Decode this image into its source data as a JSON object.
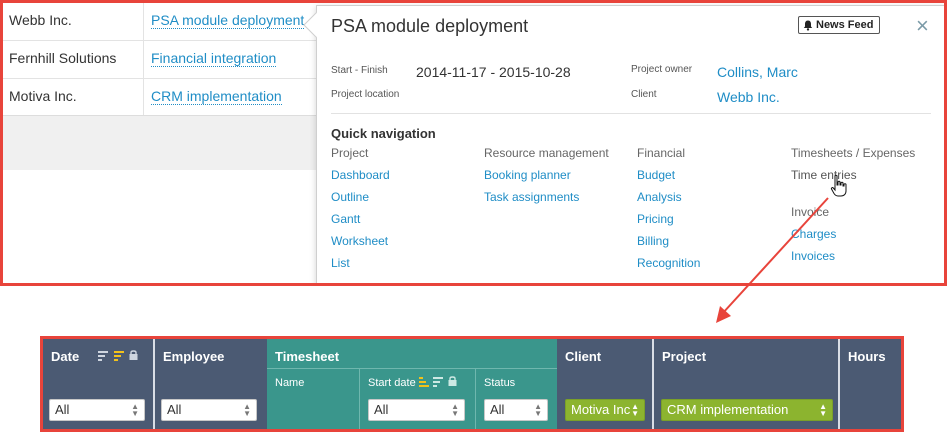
{
  "table": {
    "rows": [
      {
        "client": "Webb Inc.",
        "project": "PSA module deployment"
      },
      {
        "client": "Fernhill Solutions",
        "project": "Financial integration"
      },
      {
        "client": "Motiva Inc.",
        "project": "CRM implementation"
      }
    ]
  },
  "popup": {
    "title": "PSA module deployment",
    "news_feed_label": "News Feed",
    "close_label": "×",
    "start_finish_label": "Start - Finish",
    "start_finish_value": "2014-11-17 - 2015-10-28",
    "project_location_label": "Project location",
    "project_owner_label": "Project owner",
    "project_owner_value": "Collins, Marc",
    "client_label": "Client",
    "client_value": "Webb Inc.",
    "quick_nav_title": "Quick navigation",
    "columns": {
      "project": {
        "header": "Project",
        "links": [
          "Dashboard",
          "Outline",
          "Gantt",
          "Worksheet",
          "List"
        ]
      },
      "resource": {
        "header": "Resource management",
        "links": [
          "Booking planner",
          "Task assignments"
        ]
      },
      "financial": {
        "header": "Financial",
        "links": [
          "Budget",
          "Analysis",
          "Pricing",
          "Billing",
          "Recognition"
        ]
      },
      "timesheets": {
        "header": "Timesheets / Expenses",
        "item": "Time entries"
      },
      "invoice": {
        "header": "Invoice",
        "links": [
          "Charges",
          "Invoices"
        ]
      }
    }
  },
  "grid_header": {
    "date": {
      "label": "Date",
      "filter": "All"
    },
    "employee": {
      "label": "Employee",
      "filter": "All"
    },
    "timesheet": {
      "label": "Timesheet",
      "name_label": "Name",
      "start_date": {
        "label": "Start date",
        "filter": "All"
      },
      "status": {
        "label": "Status",
        "filter": "All"
      }
    },
    "client": {
      "label": "Client",
      "filter": "Motiva Inc"
    },
    "project": {
      "label": "Project",
      "filter": "CRM implementation"
    },
    "hours": {
      "label": "Hours"
    }
  },
  "colors": {
    "annotation": "#e8443b",
    "link": "#1f8dc6",
    "header_bg": "#4b5a73",
    "timesheet_bg": "#3a968c",
    "active_filter": "#8cb42f"
  }
}
